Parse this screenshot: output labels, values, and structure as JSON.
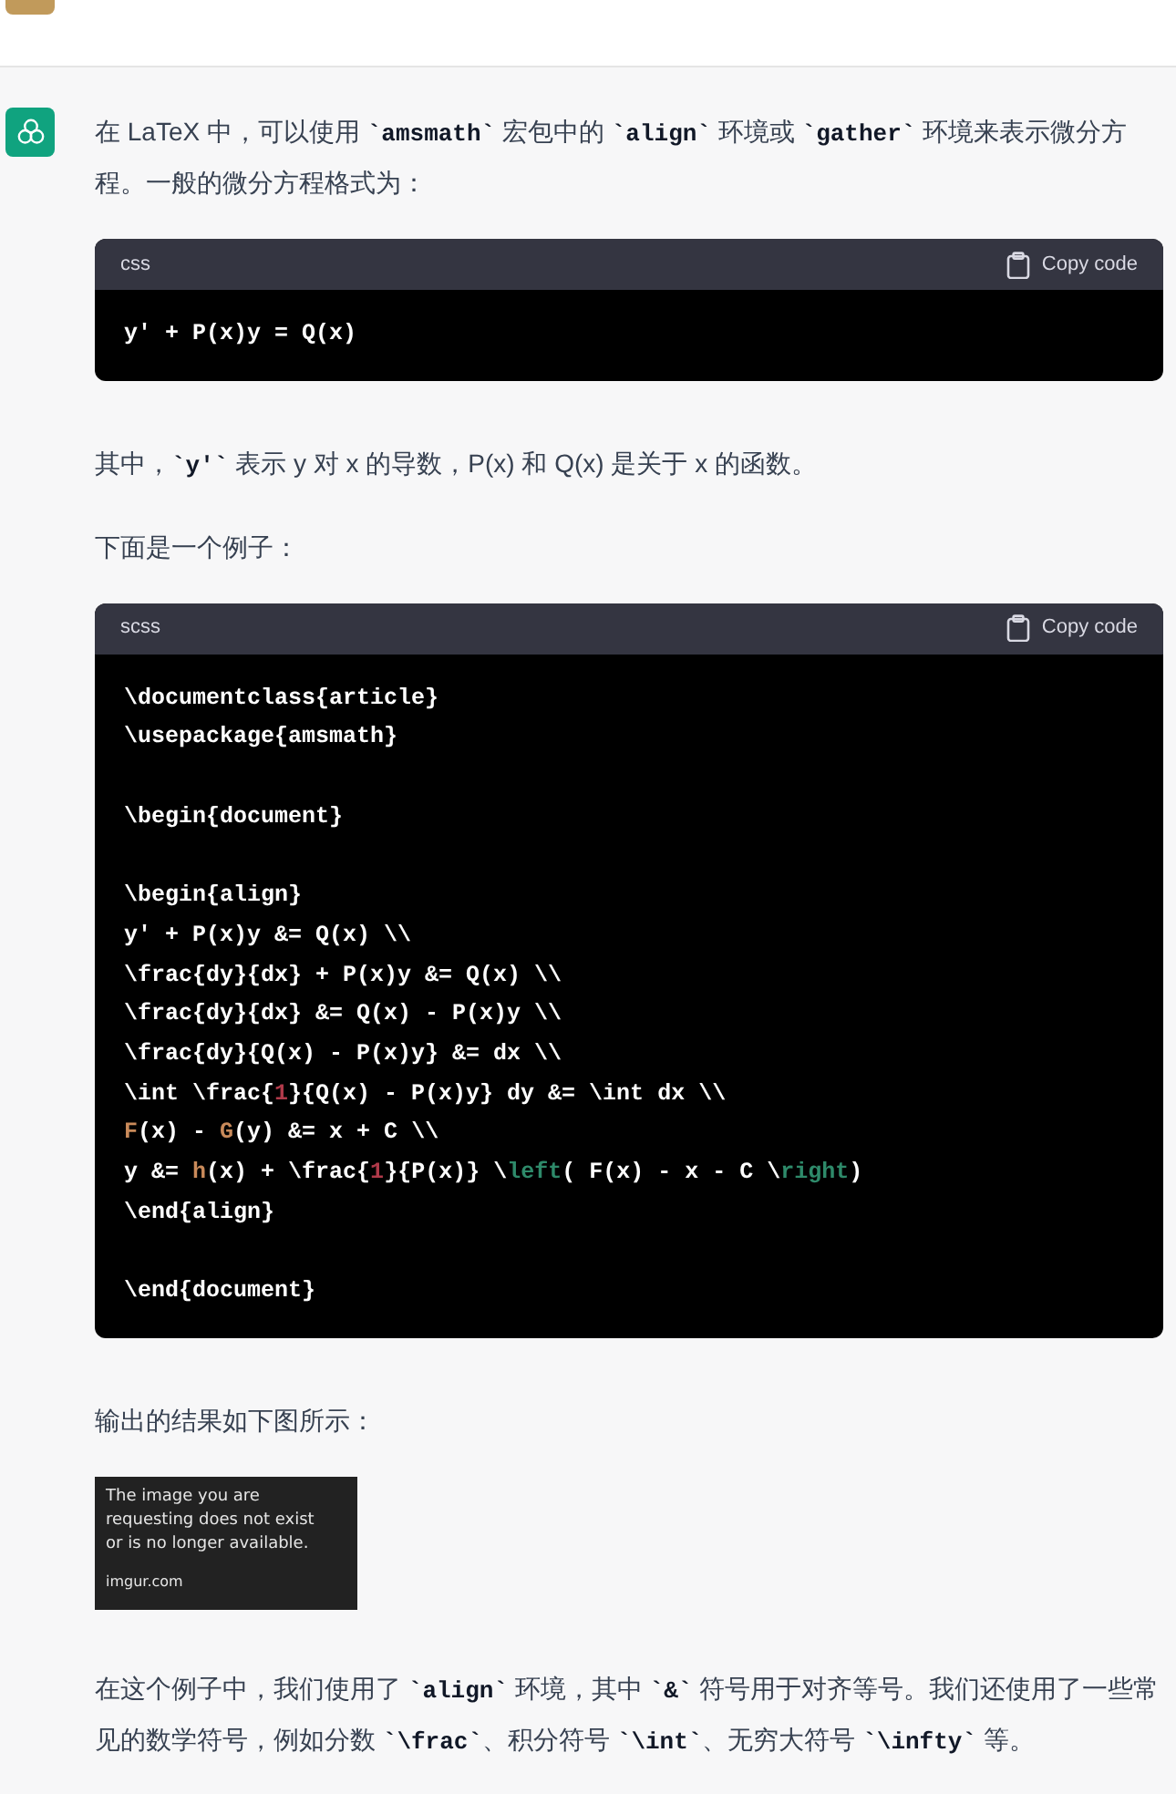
{
  "messages": [
    {
      "kind": "user"
    },
    {
      "kind": "assistant",
      "blocks": [
        {
          "kind": "paragraph",
          "segments": [
            {
              "kind": "text",
              "text": "在 LaTeX 中，可以使用 "
            },
            {
              "kind": "code",
              "text": "`amsmath`"
            },
            {
              "kind": "text",
              "text": " 宏包中的 "
            },
            {
              "kind": "code",
              "text": "`align`"
            },
            {
              "kind": "text",
              "text": " 环境或 "
            },
            {
              "kind": "code",
              "text": "`gather`"
            },
            {
              "kind": "text",
              "text": " 环境来表示微分方程。一般的微分方程格式为："
            }
          ]
        },
        {
          "kind": "code_block",
          "language": "css",
          "copy_label": "Copy code",
          "lines": [
            {
              "kind": "code",
              "tokens": [
                {
                  "text": "y' + P(x)y = Q(x)"
                }
              ]
            }
          ]
        },
        {
          "kind": "paragraph",
          "segments": [
            {
              "kind": "text",
              "text": "其中，"
            },
            {
              "kind": "code",
              "text": "`y'`"
            },
            {
              "kind": "text",
              "text": " 表示 y 对 x 的导数，P(x) 和 Q(x) 是关于 x 的函数。"
            }
          ]
        },
        {
          "kind": "paragraph",
          "segments": [
            {
              "kind": "text",
              "text": "下面是一个例子："
            }
          ]
        },
        {
          "kind": "code_block",
          "language": "scss",
          "copy_label": "Copy code",
          "lines": [
            {
              "kind": "code",
              "tokens": [
                {
                  "text": "\\documentclass{article}"
                }
              ]
            },
            {
              "kind": "code",
              "tokens": [
                {
                  "text": "\\usepackage{amsmath}"
                }
              ]
            },
            {
              "kind": "blank"
            },
            {
              "kind": "code",
              "tokens": [
                {
                  "text": "\\begin{document}"
                }
              ]
            },
            {
              "kind": "blank"
            },
            {
              "kind": "code",
              "tokens": [
                {
                  "text": "\\begin{align}"
                }
              ]
            },
            {
              "kind": "code",
              "tokens": [
                {
                  "text": "y' + P(x)y &= Q(x) \\\\"
                }
              ]
            },
            {
              "kind": "code",
              "tokens": [
                {
                  "text": "\\frac{dy}{dx} + P(x)y &= Q(x) \\\\"
                }
              ]
            },
            {
              "kind": "code",
              "tokens": [
                {
                  "text": "\\frac{dy}{dx} &= Q(x) - P(x)y \\\\"
                }
              ]
            },
            {
              "kind": "code",
              "tokens": [
                {
                  "text": "\\frac{dy}{Q(x) - P(x)y} &= dx \\\\"
                }
              ]
            },
            {
              "kind": "code",
              "tokens": [
                {
                  "text": "\\int \\frac{"
                },
                {
                  "text": "1",
                  "color": "#b03a4a"
                },
                {
                  "text": "}{Q(x) - P(x)y} dy &= \\int dx \\\\"
                }
              ]
            },
            {
              "kind": "code",
              "tokens": [
                {
                  "text": "F",
                  "color": "#c98a5a"
                },
                {
                  "text": "(x) - "
                },
                {
                  "text": "G",
                  "color": "#c98a5a"
                },
                {
                  "text": "(y) &= x + C \\\\"
                }
              ]
            },
            {
              "kind": "code",
              "tokens": [
                {
                  "text": "y &= "
                },
                {
                  "text": "h",
                  "color": "#c98a5a"
                },
                {
                  "text": "(x) + \\frac{"
                },
                {
                  "text": "1",
                  "color": "#b03a4a"
                },
                {
                  "text": "}{P(x)} \\"
                },
                {
                  "text": "left",
                  "color": "#2e8a6a"
                },
                {
                  "text": "( F(x) - x - C \\"
                },
                {
                  "text": "right",
                  "color": "#2e8a6a"
                },
                {
                  "text": ")"
                }
              ]
            },
            {
              "kind": "code",
              "tokens": [
                {
                  "text": "\\end{align}"
                }
              ]
            },
            {
              "kind": "blank"
            },
            {
              "kind": "code",
              "tokens": [
                {
                  "text": "\\end{document}"
                }
              ]
            }
          ]
        },
        {
          "kind": "paragraph",
          "segments": [
            {
              "kind": "text",
              "text": "输出的结果如下图所示："
            }
          ]
        },
        {
          "kind": "missing_image",
          "lines": [
            "The image you are",
            "requesting does not exist",
            "or is no longer available."
          ],
          "source": "imgur.com"
        },
        {
          "kind": "paragraph",
          "segments": [
            {
              "kind": "text",
              "text": "在这个例子中，我们使用了 "
            },
            {
              "kind": "code",
              "text": "`align`"
            },
            {
              "kind": "text",
              "text": " 环境，其中 "
            },
            {
              "kind": "code",
              "text": "`&`"
            },
            {
              "kind": "text",
              "text": " 符号用于对齐等号。我们还使用了一些常见的数学符号，例如分数 "
            },
            {
              "kind": "code",
              "text": "`\\frac`"
            },
            {
              "kind": "text",
              "text": "、积分符号 "
            },
            {
              "kind": "code",
              "text": "`\\int`"
            },
            {
              "kind": "text",
              "text": "、无穷大符号 "
            },
            {
              "kind": "code",
              "text": "`\\infty`"
            },
            {
              "kind": "text",
              "text": " 等。"
            }
          ]
        }
      ]
    }
  ]
}
